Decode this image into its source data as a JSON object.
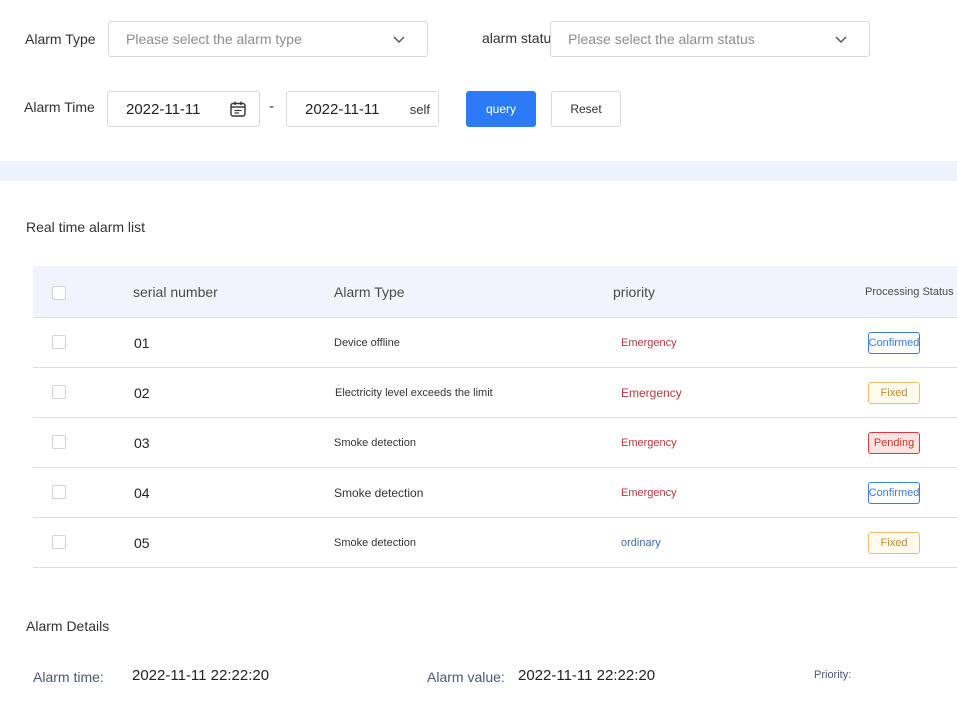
{
  "filters": {
    "alarm_type_label": "Alarm Type",
    "alarm_type_placeholder": "Please select the alarm type",
    "alarm_status_label": "alarm status",
    "alarm_status_placeholder": "Please select the alarm status",
    "alarm_time_label": "Alarm Time",
    "start_date": "2022-11-11",
    "separator": "-",
    "end_date": "2022-11-11",
    "end_suffix": "self",
    "query_label": "query",
    "reset_label": "Reset"
  },
  "list": {
    "title": "Real time alarm list",
    "columns": [
      "serial number",
      "Alarm Type",
      "priority",
      "Processing Status"
    ],
    "rows": [
      {
        "serial": "01",
        "type": "Device offline",
        "priority": "Emergency",
        "status": "Confirmed"
      },
      {
        "serial": "02",
        "type": "Electricity level exceeds the limit",
        "priority": "Emergency",
        "status": "Fixed"
      },
      {
        "serial": "03",
        "type": "Smoke detection",
        "priority": "Emergency",
        "status": "Pending"
      },
      {
        "serial": "04",
        "type": "Smoke detection",
        "priority": "Emergency",
        "status": "Confirmed"
      },
      {
        "serial": "05",
        "type": "Smoke detection",
        "priority": "ordinary",
        "status": "Fixed"
      }
    ]
  },
  "details": {
    "title": "Alarm Details",
    "alarm_time_label": "Alarm time:",
    "alarm_time_value": "2022-11-11 22:22:20",
    "alarm_value_label": "Alarm value:",
    "alarm_value_value": "2022-11-11 22:22:20",
    "priority_label": "Priority:"
  },
  "colors": {
    "primary": "#2b7bf6",
    "emergency": "#b33a3a",
    "ordinary": "#3a6db3",
    "confirmed": "#3b7dd8",
    "fixed": "#e6a23c",
    "pending": "#d93a3a"
  }
}
